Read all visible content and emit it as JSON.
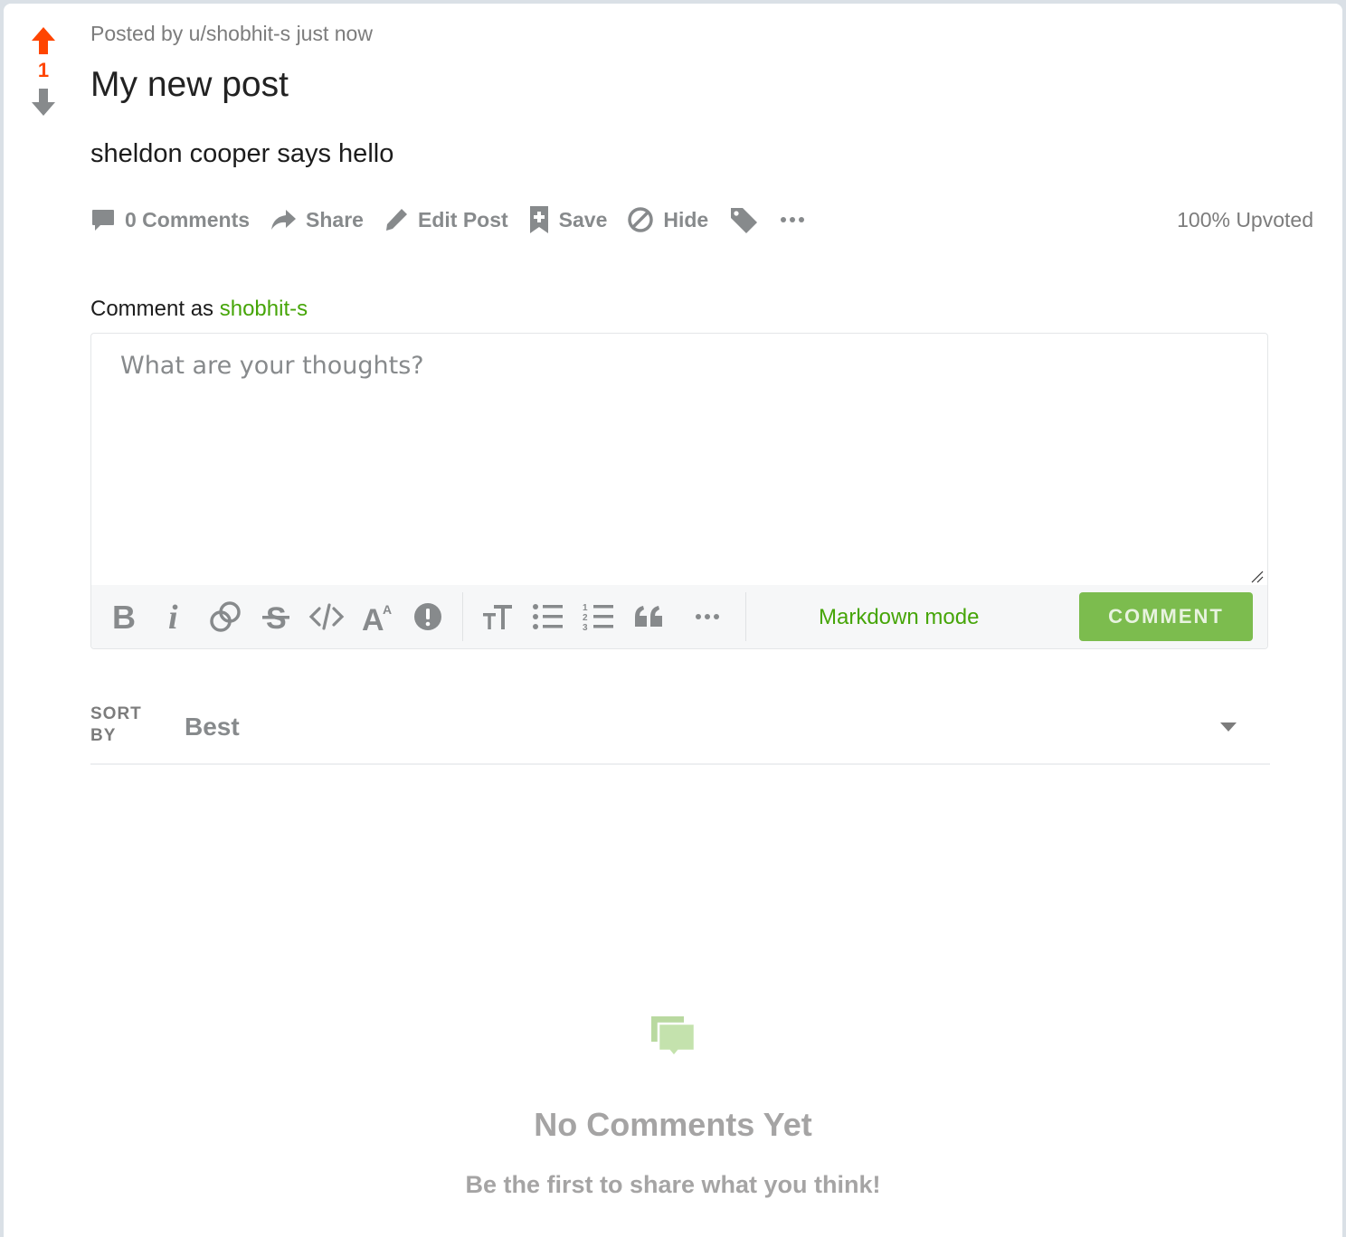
{
  "post": {
    "score": "1",
    "meta": "Posted by u/shobhit-s just now",
    "title": "My new post",
    "body": "sheldon cooper says hello",
    "upvoted": "100% Upvoted"
  },
  "actions": {
    "comments": "0 Comments",
    "share": "Share",
    "edit": "Edit Post",
    "save": "Save",
    "hide": "Hide"
  },
  "comment_box": {
    "prefix": "Comment as",
    "username": "shobhit-s",
    "placeholder": "What are your thoughts?",
    "markdown_mode": "Markdown mode",
    "submit": "COMMENT",
    "toolbar_icons": [
      "bold-icon",
      "italic-icon",
      "link-icon",
      "strikethrough-icon",
      "code-icon",
      "superscript-icon",
      "spoiler-icon",
      "heading-icon",
      "bulleted-list-icon",
      "numbered-list-icon",
      "quote-icon",
      "more-icon"
    ]
  },
  "sort": {
    "label_line1": "SORT",
    "label_line2": "BY",
    "value": "Best"
  },
  "empty_state": {
    "heading": "No Comments Yet",
    "subtext": "Be the first to share what you think!"
  },
  "colors": {
    "upvote": "#ff4500",
    "accent_green": "#46a508",
    "button_green": "#7cbc4e",
    "muted_gray": "#878a8c"
  }
}
